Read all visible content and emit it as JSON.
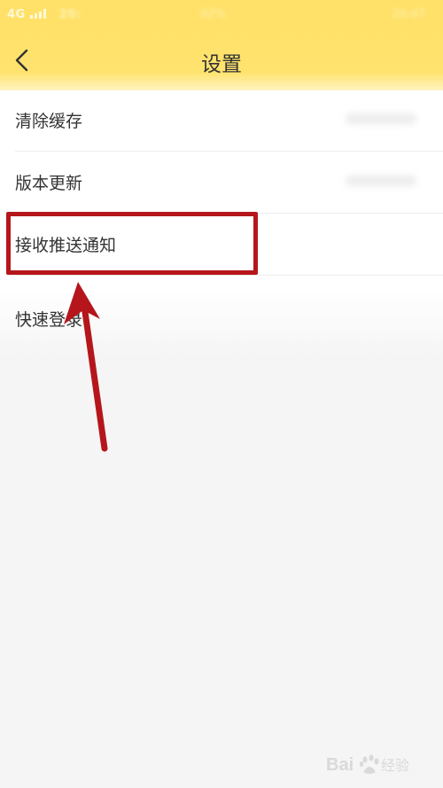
{
  "status_bar": {
    "network": "4G",
    "time": "20:",
    "center": "92%",
    "right": "20:47"
  },
  "header": {
    "title": "设置"
  },
  "settings": [
    {
      "label": "清除缓存"
    },
    {
      "label": "版本更新"
    },
    {
      "label": "接收推送通知"
    },
    {
      "label": "快速登录"
    }
  ],
  "annotation": {
    "highlight_color": "#b5161b",
    "arrow_color": "#b5161b"
  },
  "watermark": {
    "brand": "Bai",
    "suffix": "经验"
  },
  "colors": {
    "header_bg": "#ffe169",
    "page_bg": "#f5f5f5",
    "text": "#333333"
  }
}
